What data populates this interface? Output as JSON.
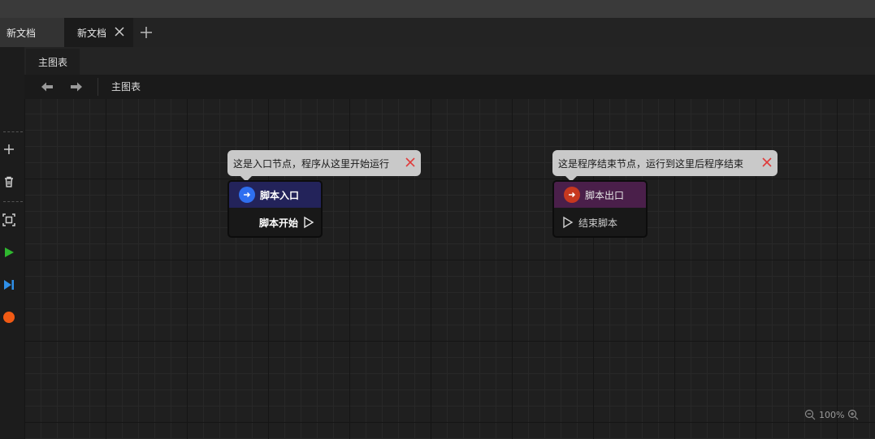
{
  "tabs": [
    {
      "label": "新文档"
    },
    {
      "label": "新文档"
    }
  ],
  "graph_tab": {
    "label": "主图表"
  },
  "breadcrumb": {
    "label": "主图表"
  },
  "tooltips": {
    "entry": "这是入口节点，程序从这里开始运行",
    "exit": "这是程序结束节点，运行到这里后程序结束"
  },
  "nodes": {
    "entry": {
      "title": "脚本入口",
      "pin": "脚本开始",
      "header_color": "#23235a",
      "icon_color": "#2f6ff0"
    },
    "exit": {
      "title": "脚本出口",
      "pin": "结束脚本",
      "header_color": "#4a1f4a",
      "icon_color": "#c7381f"
    }
  },
  "zoom": {
    "level": "100%"
  },
  "colors": {
    "play": "#2fb82f",
    "step": "#2f8fe8",
    "stop": "#f05a14",
    "tooltip_close": "#e03a3a"
  }
}
